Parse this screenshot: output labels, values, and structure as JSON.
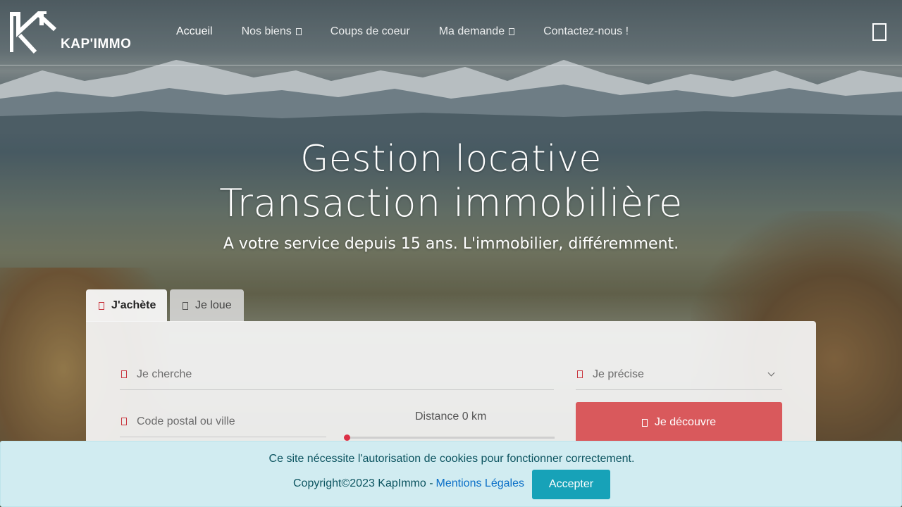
{
  "brand": {
    "logo_text": "KAP'IMMO"
  },
  "nav": {
    "items": [
      {
        "label": "Accueil",
        "active": true,
        "dropdown": false
      },
      {
        "label": "Nos biens",
        "active": false,
        "dropdown": true
      },
      {
        "label": "Coups de coeur",
        "active": false,
        "dropdown": false
      },
      {
        "label": "Ma demande",
        "active": false,
        "dropdown": true
      },
      {
        "label": "Contactez-nous !",
        "active": false,
        "dropdown": false
      }
    ]
  },
  "hero": {
    "title_line1": "Gestion locative",
    "title_line2": "Transaction immobilière",
    "subtitle": "A votre service depuis 15 ans. L'immobilier, différemment."
  },
  "search": {
    "tabs": [
      {
        "label": "J'achète",
        "active": true
      },
      {
        "label": "Je loue",
        "active": false
      }
    ],
    "search_placeholder": "Je cherche",
    "precise_placeholder": "Je précise",
    "postal_placeholder": "Code postal ou ville",
    "distance_label": "Distance 0 km",
    "distance_value_km": 0,
    "submit_label": "Je découvre"
  },
  "cookie": {
    "message": "Ce site nécessite l'autorisation de cookies pour fonctionner correctement.",
    "copyright": "Copyright©2023 KapImmo -",
    "legal_link": "Mentions Légales",
    "accept_label": "Accepter"
  },
  "colors": {
    "accent_red": "#d9595c",
    "cookie_bg": "#d1ecf1",
    "accept_button": "#17a2b8",
    "link_blue": "#0b6fc7"
  }
}
